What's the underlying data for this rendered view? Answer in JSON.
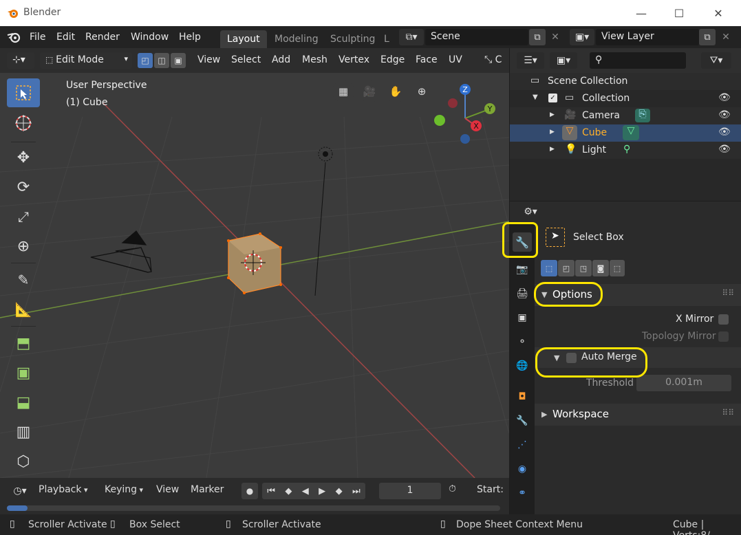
{
  "window": {
    "title": "Blender",
    "minimize": "—",
    "maximize": "☐",
    "close": "✕"
  },
  "menu": {
    "items": [
      "File",
      "Edit",
      "Render",
      "Window",
      "Help"
    ]
  },
  "workspaces": {
    "tabs": [
      "Layout",
      "Modeling",
      "Sculpting"
    ],
    "overflow": "L",
    "active": "Layout"
  },
  "scene": {
    "name": "Scene",
    "view_layer": "View Layer"
  },
  "viewport_header": {
    "mode": "Edit Mode",
    "menus": [
      "View",
      "Select",
      "Add",
      "Mesh",
      "Vertex",
      "Edge",
      "Face",
      "UV"
    ]
  },
  "viewport": {
    "perspective": "User Perspective",
    "object": "(1) Cube",
    "gizmo": {
      "x": "X",
      "y": "Y",
      "z": "Z"
    }
  },
  "outliner": {
    "root": "Scene Collection",
    "collection": "Collection",
    "items": [
      {
        "label": "Camera",
        "color": "#e6e6e6"
      },
      {
        "label": "Cube",
        "color": "#ffaf29"
      },
      {
        "label": "Light",
        "color": "#e6e6e6"
      }
    ]
  },
  "properties": {
    "tool_name": "Select Box",
    "options_label": "Options",
    "x_mirror": "X Mirror",
    "topology_mirror": "Topology Mirror",
    "auto_merge": "Auto Merge",
    "threshold_label": "Threshold",
    "threshold_value": "0.001m",
    "workspace_label": "Workspace"
  },
  "timeline": {
    "playback": "Playback",
    "keying": "Keying",
    "view": "View",
    "marker": "Marker",
    "frame": "1",
    "start": "Start:"
  },
  "status": {
    "left1": "Scroller Activate",
    "left2": "Box Select",
    "mid": "Scroller Activate",
    "right": "Dope Sheet Context Menu",
    "info": "Cube | Verts:8/"
  },
  "colors": {
    "accent": "#4772b3",
    "highlight": "#ffe600",
    "selected_object": "#ffaf29"
  }
}
